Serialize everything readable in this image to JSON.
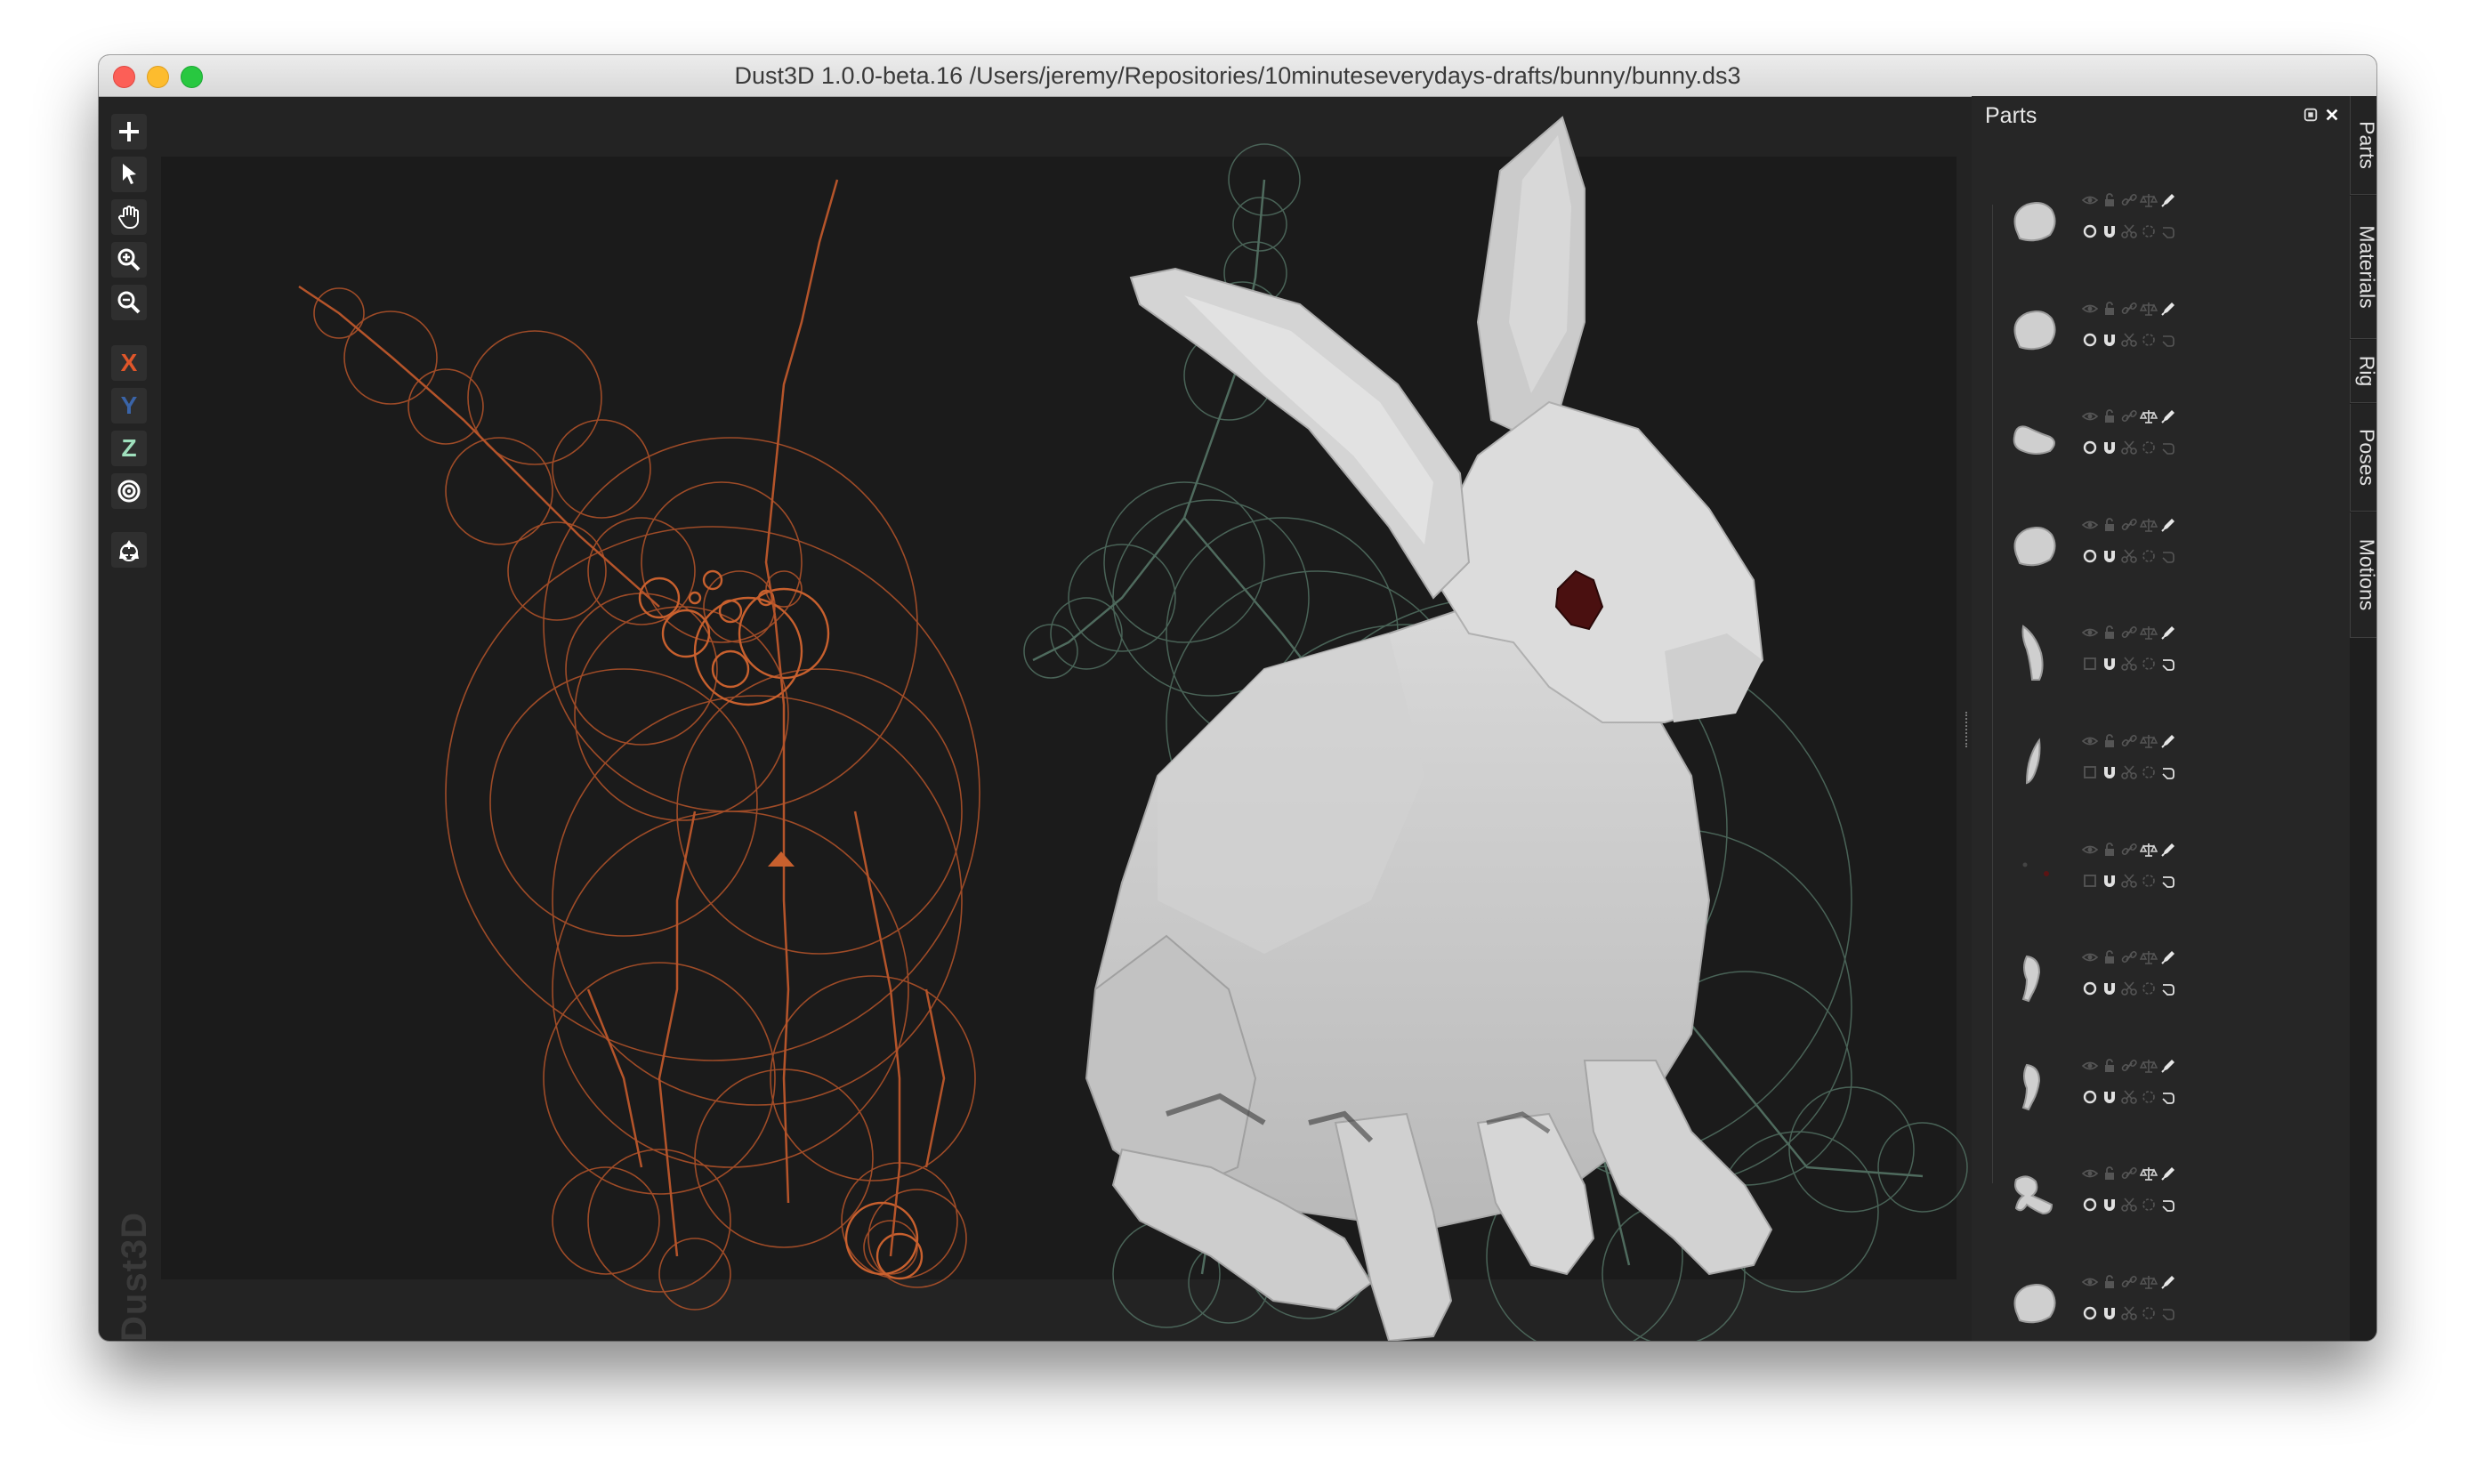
{
  "window": {
    "title": "Dust3D 1.0.0-beta.16 /Users/jeremy/Repositories/10minuteseverydays-drafts/bunny/bunny.ds3"
  },
  "toolbar": {
    "tools": [
      {
        "name": "add-icon"
      },
      {
        "name": "select-icon"
      },
      {
        "name": "pan-hand-icon"
      },
      {
        "name": "zoom-in-icon"
      },
      {
        "name": "zoom-out-icon"
      }
    ],
    "axes": [
      {
        "label": "X",
        "color": "#e0562a"
      },
      {
        "label": "Y",
        "color": "#3a64a8"
      },
      {
        "label": "Z",
        "color": "#9fe0bd"
      }
    ],
    "radial_icon": "target-icon",
    "regenerate_icon": "recycle-icon"
  },
  "watermark": "Dust3D",
  "parts_panel": {
    "title": "Parts",
    "float_icon": "float-window-icon",
    "close_icon": "close-icon",
    "parts": [
      {
        "shape": "blob",
        "balance": false,
        "eye_active": false
      },
      {
        "shape": "blob",
        "balance": false,
        "eye_active": false
      },
      {
        "shape": "bean",
        "balance": true,
        "eye_active": false
      },
      {
        "shape": "blob",
        "balance": false,
        "eye_active": false
      },
      {
        "shape": "ear",
        "balance": false,
        "eye_active": false
      },
      {
        "shape": "ear-thin",
        "balance": false,
        "eye_active": false
      },
      {
        "shape": "dots",
        "balance": true,
        "eye_active": false
      },
      {
        "shape": "leg",
        "balance": false,
        "eye_active": false
      },
      {
        "shape": "leg",
        "balance": false,
        "eye_active": false
      },
      {
        "shape": "paws",
        "balance": true,
        "eye_active": false
      },
      {
        "shape": "blob",
        "balance": false,
        "eye_active": false
      }
    ]
  },
  "side_tabs": [
    "Parts",
    "Materials",
    "Rig",
    "Poses",
    "Motions"
  ],
  "colors": {
    "front_view_lines": "#b5542a",
    "side_view_lines": "#4f6b5e",
    "mesh": "#cfcfcf",
    "eye": "#4a1010"
  }
}
